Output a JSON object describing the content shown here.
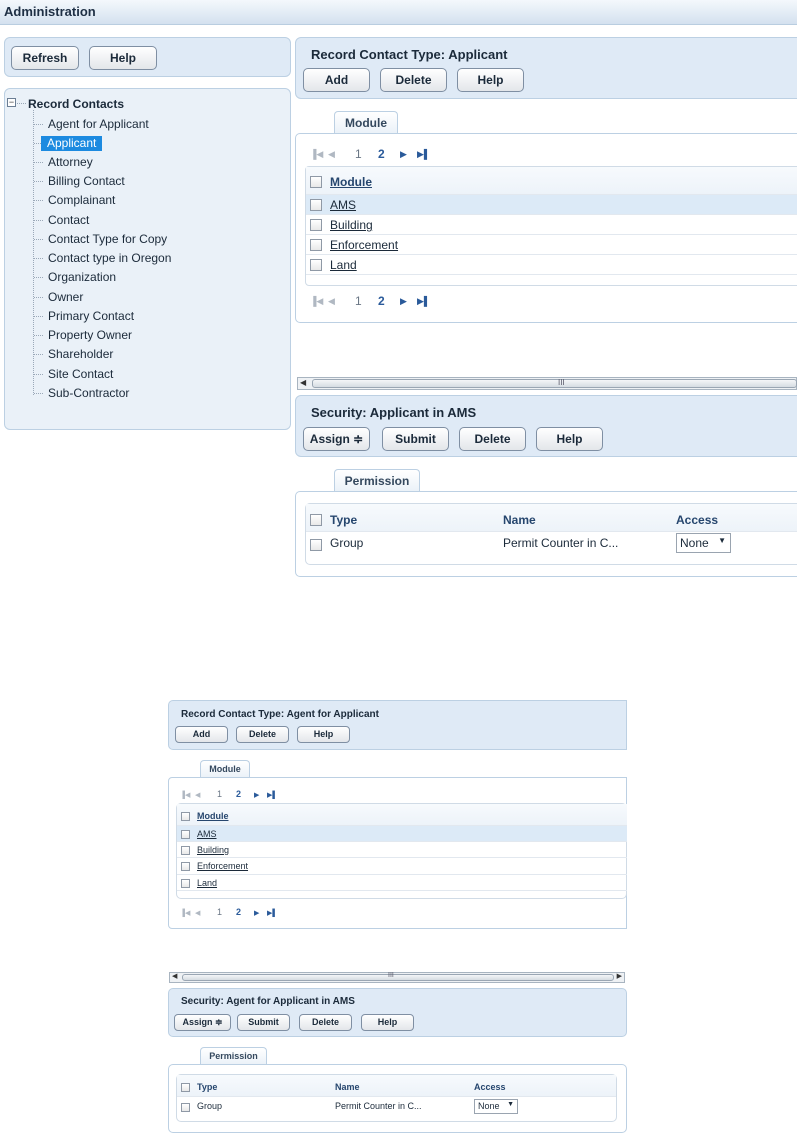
{
  "header": {
    "title": "Administration"
  },
  "left": {
    "refresh_label": "Refresh",
    "help_label": "Help",
    "tree": {
      "root": "Record Contacts",
      "items": [
        "Agent for Applicant",
        "Applicant",
        "Attorney",
        "Billing Contact",
        "Complainant",
        "Contact",
        "Contact Type for Copy",
        "Contact type in Oregon",
        "Organization",
        "Owner",
        "Primary Contact",
        "Property Owner",
        "Shareholder",
        "Site Contact",
        "Sub-Contractor"
      ],
      "selected": "Applicant"
    }
  },
  "main": {
    "title": "Record Contact Type: Applicant",
    "add_label": "Add",
    "delete_label": "Delete",
    "help_label": "Help",
    "tab": "Module",
    "pager": {
      "page1": "1",
      "page2": "2"
    },
    "module_header": "Module",
    "modules": [
      "AMS",
      "Building",
      "Enforcement",
      "Land"
    ],
    "security_title": "Security: Applicant in AMS",
    "assign_label": "Assign",
    "submit_label": "Submit",
    "perm_tab": "Permission",
    "perm_cols": [
      "Type",
      "Name",
      "Access"
    ],
    "perm_row": {
      "type": "Group",
      "name": "Permit Counter in C...",
      "access": "None"
    },
    "scroll_grip": "III"
  },
  "second": {
    "title": "Record Contact Type: Agent for Applicant",
    "add_label": "Add",
    "delete_label": "Delete",
    "help_label": "Help",
    "tab": "Module",
    "pager": {
      "page1": "1",
      "page2": "2"
    },
    "module_header": "Module",
    "modules": [
      "AMS",
      "Building",
      "Enforcement",
      "Land"
    ],
    "security_title": "Security: Agent for Applicant in AMS",
    "assign_label": "Assign",
    "submit_label": "Submit",
    "perm_tab": "Permission",
    "perm_cols": [
      "Type",
      "Name",
      "Access"
    ],
    "perm_row": {
      "type": "Group",
      "name": "Permit Counter in C...",
      "access": "None"
    },
    "scroll_grip": "III"
  },
  "colors": {
    "selected": "#1c8ae0",
    "panel": "#dfeaf6",
    "link": "#26466e"
  }
}
